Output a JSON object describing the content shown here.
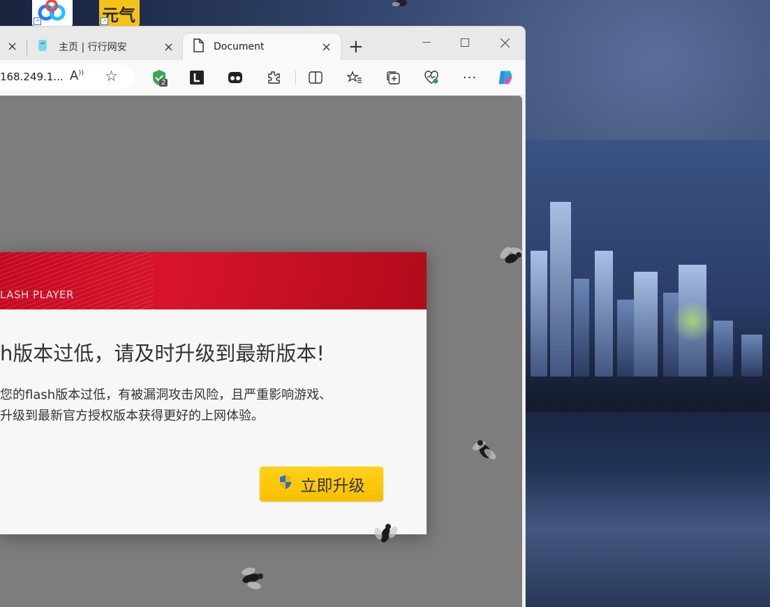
{
  "browser": {
    "tabs": [
      {
        "label": "主页 | 行行网安",
        "icon": "page-favicon-icon",
        "active": false
      },
      {
        "label": "Document",
        "icon": "document-icon",
        "active": true
      }
    ],
    "close_glyph": "×",
    "new_tab_glyph": "+",
    "address": {
      "text": "168.249.1..."
    },
    "extension_badge_count": "2",
    "window_controls": [
      "minimize",
      "maximize",
      "close"
    ]
  },
  "dialog": {
    "banner_text": "LASH PLAYER",
    "title": "h版本过低，请及时升级到最新版本!",
    "body_lines": [
      "您的flash版本过低，有被漏洞攻击风险，且严重影响游戏、",
      "升级到最新官方授权版本获得更好的上网体验。"
    ],
    "button_label": "立即升级",
    "colors": {
      "banner": "#c5081f",
      "button": "#ffc800"
    }
  },
  "desktop": {
    "icons": [
      "baidu-netdisk-icon",
      "yuanqi-app-icon"
    ],
    "icon_text": "元气"
  }
}
